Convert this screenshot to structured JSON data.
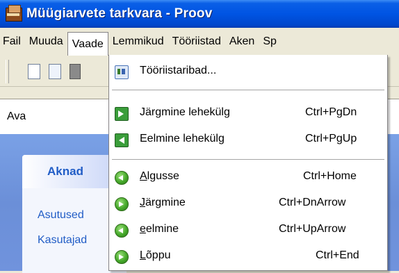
{
  "window": {
    "title": "Müügiarvete tarkvara - Proov"
  },
  "menubar": {
    "items": [
      {
        "label": "Fail"
      },
      {
        "label": "Muuda"
      },
      {
        "label": "Vaade"
      },
      {
        "label": "Lemmikud"
      },
      {
        "label": "Tööriistad"
      },
      {
        "label": "Aken"
      },
      {
        "label": "Sp"
      }
    ]
  },
  "address": {
    "label": "Ava"
  },
  "panel": {
    "title": "Aknad",
    "links": [
      "Asutused",
      "Kasutajad"
    ]
  },
  "dropdown": {
    "items": [
      {
        "label": "Tööriistaribad...",
        "shortcut": "",
        "icon": "toolbars-icon"
      },
      {
        "label": "Järgmine lehekülg",
        "shortcut": "Ctrl+PgDn",
        "icon": "next-page-icon"
      },
      {
        "label": "Eelmine lehekülg",
        "shortcut": "Ctrl+PgUp",
        "icon": "previous-page-icon"
      },
      {
        "label_ul": "A",
        "label_rest": "lgusse",
        "shortcut": "Ctrl+Home",
        "icon": "first-record-icon"
      },
      {
        "label_ul": "J",
        "label_rest": "ärgmine",
        "shortcut": "Ctrl+DnArrow",
        "icon": "next-record-icon"
      },
      {
        "label_ul": "e",
        "label_rest": "elmine",
        "shortcut": "Ctrl+UpArrow",
        "icon": "previous-record-icon"
      },
      {
        "label_ul": "L",
        "label_rest": "õppu",
        "shortcut": "Ctrl+End",
        "icon": "last-record-icon"
      }
    ]
  }
}
